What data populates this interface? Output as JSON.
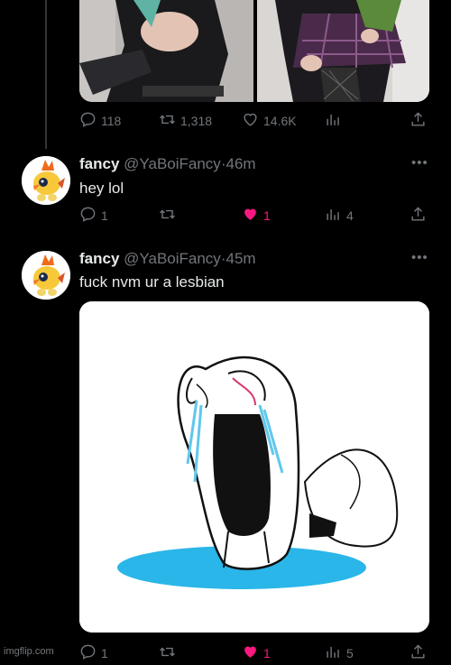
{
  "prev_tweet": {
    "stats": {
      "replies": "118",
      "retweets": "1,318",
      "likes": "14.6K",
      "views": ""
    }
  },
  "tweets": [
    {
      "name": "fancy",
      "handle": "@YaBoiFancy",
      "time": "46m",
      "text": "hey lol",
      "stats": {
        "replies": "1",
        "retweets": "",
        "likes": "1",
        "views": "4"
      }
    },
    {
      "name": "fancy",
      "handle": "@YaBoiFancy",
      "time": "45m",
      "text": "fuck nvm ur a lesbian",
      "stats": {
        "replies": "1",
        "retweets": "",
        "likes": "1",
        "views": "5"
      }
    }
  ],
  "icons": {
    "reply": "reply-icon",
    "retweet": "retweet-icon",
    "like": "heart-icon",
    "views": "views-icon",
    "share": "share-icon",
    "more": "more-icon"
  },
  "colors": {
    "like_active": "#f91880",
    "muted": "#71767b",
    "text": "#e7e9ea",
    "puddle": "#29b6e8"
  },
  "watermark": "imgflip.com"
}
